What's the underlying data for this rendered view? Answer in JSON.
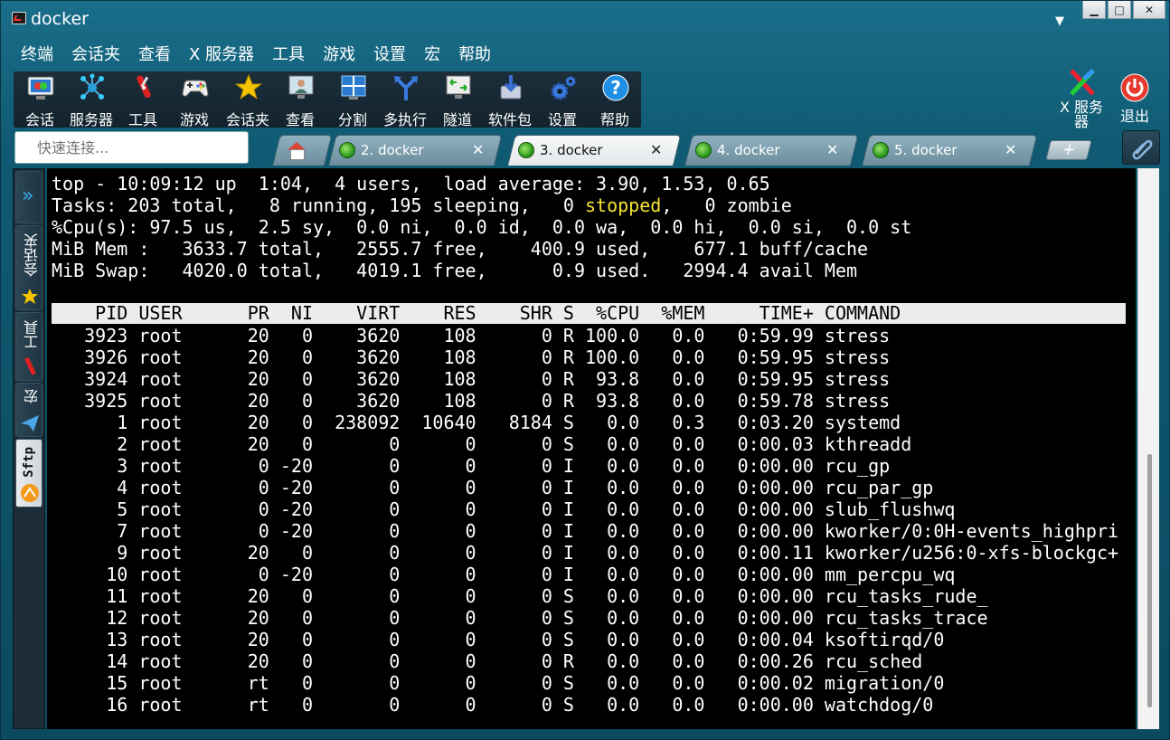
{
  "window": {
    "title": "docker",
    "buttons": [
      "▁",
      "□",
      "✕"
    ]
  },
  "menu": [
    "终端",
    "会话夹",
    "查看",
    "X 服务器",
    "工具",
    "游戏",
    "设置",
    "宏",
    "帮助"
  ],
  "toolbar": [
    {
      "label": "会话",
      "icon": "session-icon"
    },
    {
      "label": "服务器",
      "icon": "server-icon"
    },
    {
      "label": "工具",
      "icon": "tools-icon"
    },
    {
      "label": "游戏",
      "icon": "gamepad-icon"
    },
    {
      "label": "会话夹",
      "icon": "star-icon"
    },
    {
      "label": "查看",
      "icon": "view-icon"
    },
    {
      "label": "分割",
      "icon": "split-icon"
    },
    {
      "label": "多执行",
      "icon": "multiexec-icon"
    },
    {
      "label": "隧道",
      "icon": "tunnel-icon"
    },
    {
      "label": "软件包",
      "icon": "package-icon"
    },
    {
      "label": "设置",
      "icon": "gear-icon"
    },
    {
      "label": "帮助",
      "icon": "help-icon"
    }
  ],
  "toolbar_right": {
    "xserver": "X 服务\n器",
    "exit": "退出"
  },
  "quick_connect": {
    "placeholder": "快速连接..."
  },
  "tabs": [
    {
      "label": "2. docker"
    },
    {
      "label": "3. docker"
    },
    {
      "label": "4. docker"
    },
    {
      "label": "5. docker"
    }
  ],
  "sidebar": {
    "sessions": "会话夹",
    "tools": "工具",
    "macros": "宏",
    "sftp": "Sftp"
  },
  "terminal": {
    "summary": {
      "line1": "top - 10:09:12 up  1:04,  4 users,  load average: 3.90, 1.53, 0.65",
      "line2a": "Tasks: 203 total,   8 running, 195 sleeping,   0 ",
      "line2b": "stopped",
      "line2c": ",   0 zombie",
      "line3": "%Cpu(s): 97.5 us,  2.5 sy,  0.0 ni,  0.0 id,  0.0 wa,  0.0 hi,  0.0 si,  0.0 st",
      "line4": "MiB Mem :   3633.7 total,   2555.7 free,    400.9 used,    677.1 buff/cache",
      "line5": "MiB Swap:   4020.0 total,   4019.1 free,      0.9 used.   2994.4 avail Mem"
    },
    "header": "    PID USER      PR  NI    VIRT    RES    SHR S  %CPU  %MEM     TIME+ COMMAND",
    "rows": [
      "   3923 root      20   0    3620    108      0 R 100.0   0.0   0:59.99 stress",
      "   3926 root      20   0    3620    108      0 R 100.0   0.0   0:59.95 stress",
      "   3924 root      20   0    3620    108      0 R  93.8   0.0   0:59.95 stress",
      "   3925 root      20   0    3620    108      0 R  93.8   0.0   0:59.78 stress",
      "      1 root      20   0  238092  10640   8184 S   0.0   0.3   0:03.20 systemd",
      "      2 root      20   0       0      0      0 S   0.0   0.0   0:00.03 kthreadd",
      "      3 root       0 -20       0      0      0 I   0.0   0.0   0:00.00 rcu_gp",
      "      4 root       0 -20       0      0      0 I   0.0   0.0   0:00.00 rcu_par_gp",
      "      5 root       0 -20       0      0      0 I   0.0   0.0   0:00.00 slub_flushwq",
      "      7 root       0 -20       0      0      0 I   0.0   0.0   0:00.00 kworker/0:0H-events_highpri",
      "      9 root      20   0       0      0      0 I   0.0   0.0   0:00.11 kworker/u256:0-xfs-blockgc+",
      "     10 root       0 -20       0      0      0 I   0.0   0.0   0:00.00 mm_percpu_wq",
      "     11 root      20   0       0      0      0 S   0.0   0.0   0:00.00 rcu_tasks_rude_",
      "     12 root      20   0       0      0      0 S   0.0   0.0   0:00.00 rcu_tasks_trace",
      "     13 root      20   0       0      0      0 S   0.0   0.0   0:00.04 ksoftirqd/0",
      "     14 root      20   0       0      0      0 R   0.0   0.0   0:00.26 rcu_sched",
      "     15 root      rt   0       0      0      0 S   0.0   0.0   0:00.02 migration/0",
      "     16 root      rt   0       0      0      0 S   0.0   0.0   0:00.00 watchdog/0"
    ]
  },
  "colors": {
    "stopped": "#f7e433",
    "terminal_bg": "#000000"
  }
}
